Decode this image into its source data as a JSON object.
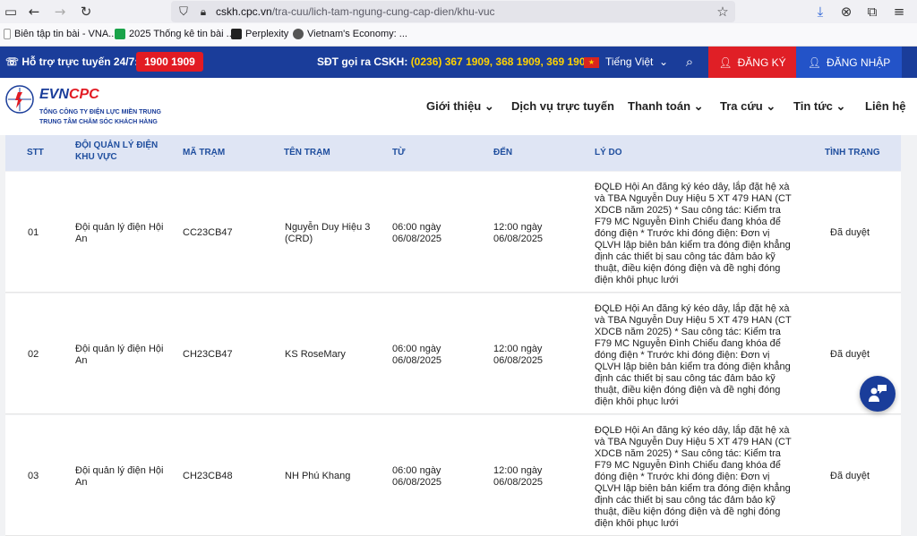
{
  "browser": {
    "url_domain": "cskh.cpc.vn",
    "url_path": "/tra-cuu/lich-tam-ngung-cung-cap-dien/khu-vuc",
    "bookmarks": [
      "Biên tập tin bài - VNA...",
      "2025 Thống kê tin bài ...",
      "Perplexity",
      "Vietnam's Economy: ..."
    ]
  },
  "topbar": {
    "support_label": "Hỗ trợ trực tuyến 24/7:",
    "hotline": "1900 1909",
    "cskh_label": "SĐT gọi ra CSKH:",
    "cskh_numbers": "(0236) 367 1909, 368 1909, 369 1909",
    "language": "Tiếng Việt",
    "register": "ĐĂNG KÝ",
    "login": "ĐĂNG NHẬP"
  },
  "header": {
    "logo_evn": "EVN",
    "logo_cpc": "CPC",
    "logo_sub1": "TỔNG CÔNG TY ĐIỆN LỰC MIỀN TRUNG",
    "logo_sub2": "TRUNG TÂM CHĂM SÓC KHÁCH HÀNG",
    "menu": [
      "Giới thiệu",
      "Dịch vụ trực tuyến",
      "Thanh toán",
      "Tra cứu",
      "Tin tức",
      "Liên hệ"
    ]
  },
  "table": {
    "columns": [
      "STT",
      "ĐỘI QUẢN LÝ ĐIỆN KHU VỰC",
      "MÃ TRẠM",
      "TÊN TRẠM",
      "TỪ",
      "ĐẾN",
      "LÝ DO",
      "TÌNH TRẠNG"
    ],
    "rows": [
      {
        "stt": "01",
        "team": "Đội quản lý điện Hội An",
        "code": "CC23CB47",
        "name": "Nguyễn Duy Hiệu 3 (CRD)",
        "from": "06:00 ngày 06/08/2025",
        "to": "12:00 ngày 06/08/2025",
        "reason": "ĐQLĐ Hội An đăng ký kéo dây, lắp đặt hệ xà và TBA Nguyễn Duy Hiệu 5 XT 479 HAN (CT XDCB năm 2025) * Sau công tác: Kiểm tra F79 MC Nguyễn Đình Chiểu đang khóa để đóng điện * Trước khi đóng điện: Đơn vị QLVH lập biên bản kiểm tra đóng điện khẳng định các thiết bị sau công tác đảm bảo kỹ thuật, điều kiện đóng điện và đề nghị đóng điện khôi phục lưới",
        "status": "Đã duyệt"
      },
      {
        "stt": "02",
        "team": "Đội quản lý điện Hội An",
        "code": "CH23CB47",
        "name": "KS RoseMary",
        "from": "06:00 ngày 06/08/2025",
        "to": "12:00 ngày 06/08/2025",
        "reason": "ĐQLĐ Hội An đăng ký kéo dây, lắp đặt hệ xà và TBA Nguyễn Duy Hiệu 5 XT 479 HAN (CT XDCB năm 2025) * Sau công tác: Kiểm tra F79 MC Nguyễn Đình Chiểu đang khóa để đóng điện * Trước khi đóng điện: Đơn vị QLVH lập biên bản kiểm tra đóng điện khẳng định các thiết bị sau công tác đảm bảo kỹ thuật, điều kiện đóng điện và đề nghị đóng điện khôi phục lưới",
        "status": "Đã duyệt"
      },
      {
        "stt": "03",
        "team": "Đội quản lý điện Hội An",
        "code": "CH23CB48",
        "name": "NH Phú Khang",
        "from": "06:00 ngày 06/08/2025",
        "to": "12:00 ngày 06/08/2025",
        "reason": "ĐQLĐ Hội An đăng ký kéo dây, lắp đặt hệ xà và TBA Nguyễn Duy Hiệu 5 XT 479 HAN (CT XDCB năm 2025) * Sau công tác: Kiểm tra F79 MC Nguyễn Đình Chiểu đang khóa để đóng điện * Trước khi đóng điện: Đơn vị QLVH lập biên bản kiểm tra đóng điện khẳng định các thiết bị sau công tác đảm bảo kỹ thuật, điều kiện đóng điện và đề nghị đóng điện khôi phục lưới",
        "status": "Đã duyệt"
      }
    ]
  }
}
